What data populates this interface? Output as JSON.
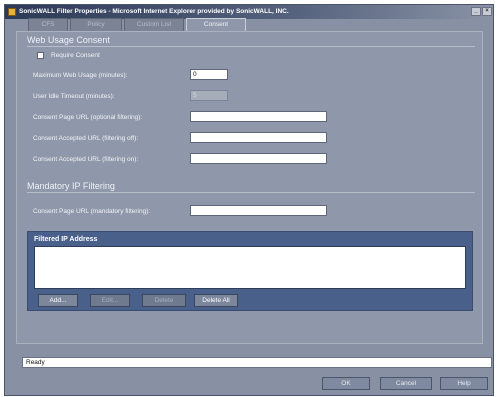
{
  "window": {
    "title": "SonicWALL Filter Properties - Microsoft Internet Explorer provided by SonicWALL, INC."
  },
  "tabs": [
    {
      "label": "CFS"
    },
    {
      "label": "Policy"
    },
    {
      "label": "Custom List"
    },
    {
      "label": "Consent"
    }
  ],
  "web_usage": {
    "title": "Web Usage Consent",
    "require_consent_label": "Require Consent",
    "require_consent_checked": false,
    "max_usage_label": "Maximum Web Usage (minutes):",
    "max_usage_value": "0",
    "idle_timeout_label": "User Idle Timeout (minutes):",
    "idle_timeout_value": "5",
    "consent_url_optional_label": "Consent Page URL (optional filtering):",
    "consent_url_optional_value": "",
    "accepted_off_label": "Consent Accepted URL (filtering off):",
    "accepted_off_value": "",
    "accepted_on_label": "Consent Accepted URL (filtering on):",
    "accepted_on_value": ""
  },
  "mandatory": {
    "title": "Mandatory IP Filtering",
    "consent_url_mandatory_label": "Consent Page URL (mandatory filtering):",
    "consent_url_mandatory_value": ""
  },
  "filtered_ip": {
    "header": "Filtered IP Address",
    "items": [],
    "buttons": {
      "add": "Add...",
      "edit": "Edit...",
      "delete": "Delete",
      "delete_all": "Delete All"
    }
  },
  "status": {
    "text": "Ready"
  },
  "footer": {
    "ok": "OK",
    "cancel": "Cancel",
    "help": "Help"
  }
}
